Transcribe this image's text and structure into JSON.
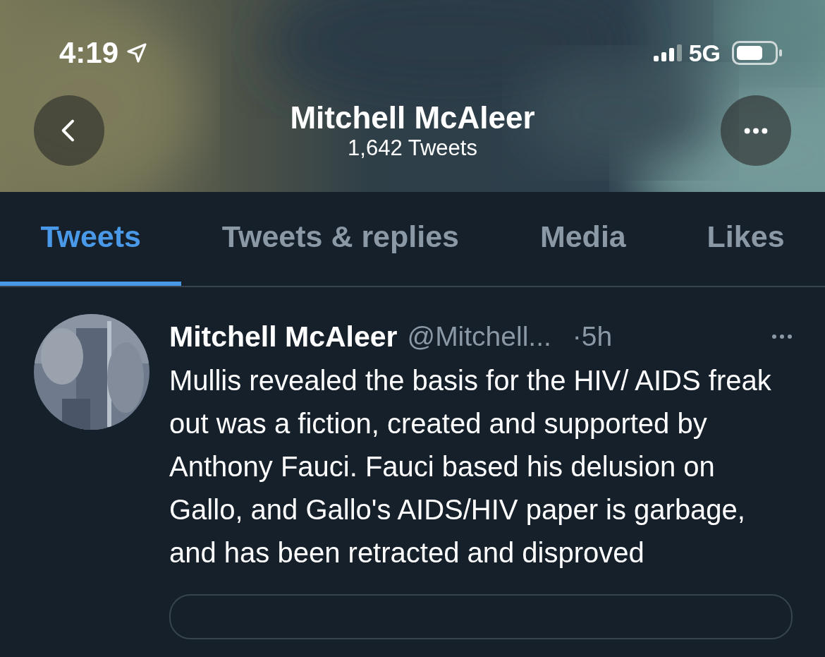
{
  "status_bar": {
    "time": "4:19",
    "network": "5G"
  },
  "header": {
    "name": "Mitchell McAleer",
    "tweet_count": "1,642 Tweets"
  },
  "tabs": [
    {
      "label": "Tweets",
      "selected": true
    },
    {
      "label": "Tweets & replies",
      "selected": false
    },
    {
      "label": "Media",
      "selected": false
    },
    {
      "label": "Likes",
      "selected": false
    }
  ],
  "tweet": {
    "name": "Mitchell McAleer",
    "handle": "@Mitchell...",
    "time": "·5h",
    "text": "Mullis revealed the basis for the HIV/ AIDS freak out was a fiction, created and supported by Anthony Fauci. Fauci based his delusion on Gallo, and Gallo's AIDS/HIV paper is garbage, and has been retracted and disproved"
  }
}
